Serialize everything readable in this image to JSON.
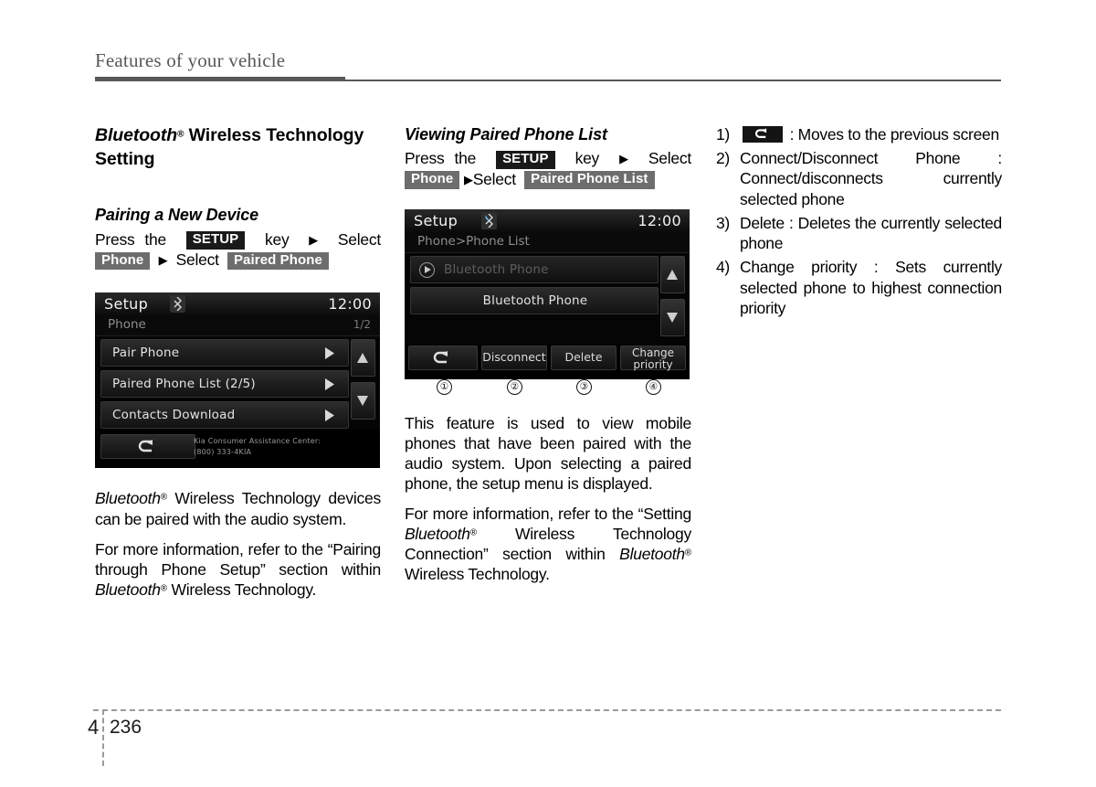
{
  "header": {
    "title": "Features of your vehicle"
  },
  "footer": {
    "chapter": "4",
    "page": "236"
  },
  "col1": {
    "section_title_bt": "Bluetooth",
    "section_title_rest": " Wireless Technology Setting",
    "subtitle": "Pairing a New Device",
    "steps": {
      "press_the": "Press the",
      "setup_key": "SETUP",
      "key_word": "key",
      "select_1": "Select",
      "chip_phone": "Phone",
      "select_2": "Select",
      "chip_paired_phone": "Paired Phone"
    },
    "para1_bt": "Bluetooth",
    "para1_rest": " Wireless Technology devices can be paired with the audio system.",
    "para2_a": "For more information, refer to the “Pairing through Phone Setup” section within ",
    "para2_bt": "Bluetooth",
    "para2_b": " Wireless Technology."
  },
  "col2": {
    "subtitle": "Viewing Paired Phone List",
    "steps": {
      "press_the": "Press the",
      "setup_key": "SETUP",
      "key_word": "key",
      "select_1": "Select",
      "chip_phone": "Phone",
      "select_2": "Select",
      "chip_paired_phone_list": "Paired Phone List"
    },
    "para1": "This feature is used to view mobile phones that have been paired with the audio system. Upon selecting a paired phone, the setup menu is displayed.",
    "para2_a": "For more information, refer to the “Setting ",
    "para2_bt1": "Bluetooth",
    "para2_b": " Wireless Technology Connection” section within ",
    "para2_bt2": "Bluetooth",
    "para2_c": " Wireless Technology."
  },
  "col3": {
    "items": [
      {
        "marker": "1)",
        "icon": "back-arrow-icon",
        "text": ": Moves to the previous screen"
      },
      {
        "marker": "2)",
        "text": "Connect/Disconnect Phone : Connect/disconnects currently selected phone"
      },
      {
        "marker": "3)",
        "text": "Delete : Deletes the currently selected phone"
      },
      {
        "marker": "4)",
        "text": "Change priority : Sets currently selected phone to highest connection priority"
      }
    ]
  },
  "device1": {
    "status": {
      "title": "Setup",
      "clock": "12:00",
      "bluetooth_icon": "bluetooth-icon"
    },
    "breadcrumb": {
      "path": "Phone",
      "page": "1/2"
    },
    "rows": [
      {
        "label": "Pair Phone"
      },
      {
        "label": "Paired Phone List (2/5)"
      },
      {
        "label": "Contacts Download"
      }
    ],
    "scroll": {
      "up": "scroll-up-icon",
      "down": "scroll-down-icon"
    },
    "bottom": {
      "back_icon": "back-arrow-icon",
      "note_line1": "Kia Consumer Assistance Center:",
      "note_line2": "(800) 333-4KIA"
    }
  },
  "device2": {
    "status": {
      "title": "Setup",
      "clock": "12:00",
      "bluetooth_icon": "bluetooth-call-icon"
    },
    "breadcrumb": {
      "path": "Phone>Phone List"
    },
    "rows": [
      {
        "label": "Bluetooth Phone",
        "state": "dim",
        "badge": "play-icon"
      },
      {
        "label": "Bluetooth Phone",
        "state": "normal"
      }
    ],
    "scroll": {
      "up": "scroll-up-icon",
      "down": "scroll-down-icon"
    },
    "bottom_buttons": [
      {
        "label": "",
        "icon": "back-arrow-icon"
      },
      {
        "label": "Disconnect"
      },
      {
        "label": "Delete"
      },
      {
        "label": "Change priority",
        "line1": "Change",
        "line2": "priority"
      }
    ],
    "callouts": [
      "①",
      "②",
      "③",
      "④"
    ]
  }
}
